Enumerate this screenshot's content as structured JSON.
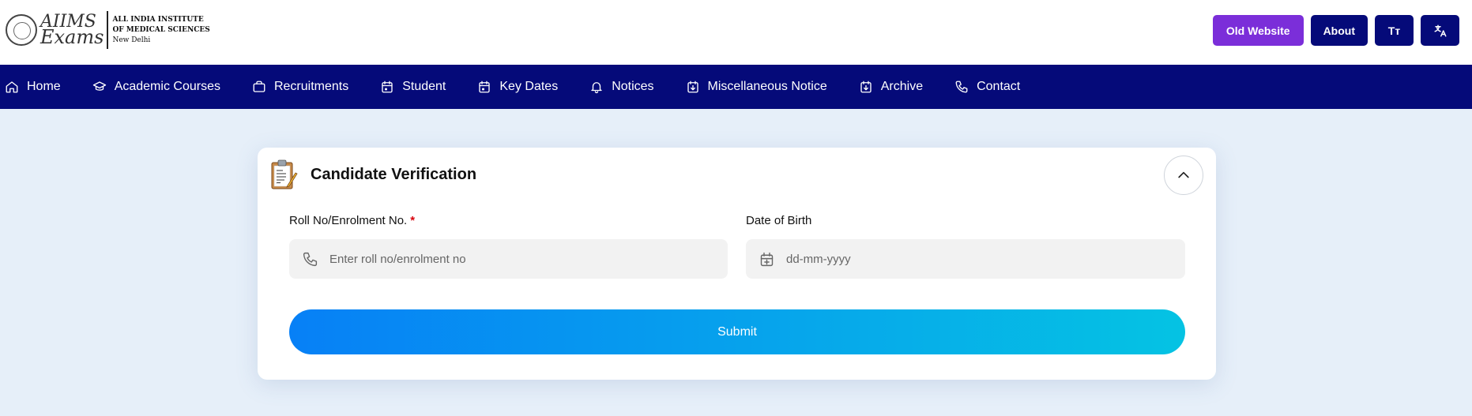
{
  "header": {
    "logo": {
      "script_line1": "AIIMS",
      "script_line2": "Exams",
      "institute_line1": "ALL INDIA INSTITUTE",
      "institute_line2": "OF MEDICAL SCIENCES",
      "institute_line3": "New Delhi"
    },
    "buttons": {
      "old_website": "Old Website",
      "about": "About",
      "text_size": "Tт"
    }
  },
  "nav": {
    "items": [
      {
        "label": "Home",
        "icon": "home-icon"
      },
      {
        "label": "Academic Courses",
        "icon": "graduation-cap-icon"
      },
      {
        "label": "Recruitments",
        "icon": "briefcase-icon"
      },
      {
        "label": "Student",
        "icon": "calendar-icon"
      },
      {
        "label": "Key Dates",
        "icon": "calendar-icon"
      },
      {
        "label": "Notices",
        "icon": "bell-icon"
      },
      {
        "label": "Miscellaneous Notice",
        "icon": "calendar-download-icon"
      },
      {
        "label": "Archive",
        "icon": "calendar-download-icon"
      },
      {
        "label": "Contact",
        "icon": "phone-icon"
      }
    ]
  },
  "card": {
    "title": "Candidate Verification",
    "roll": {
      "label": "Roll No/Enrolment No.",
      "required_mark": "*",
      "placeholder": "Enter roll no/enrolment no",
      "value": ""
    },
    "dob": {
      "label": "Date of Birth",
      "placeholder": "dd-mm-yyyy",
      "value": ""
    },
    "submit_label": "Submit"
  },
  "colors": {
    "nav_bg": "#050a79",
    "old_website_bg": "#7b2ed9",
    "page_bg": "#e6eff9",
    "submit_gradient_start": "#0780f6",
    "submit_gradient_end": "#05c3e3",
    "required": "#d8000c"
  }
}
